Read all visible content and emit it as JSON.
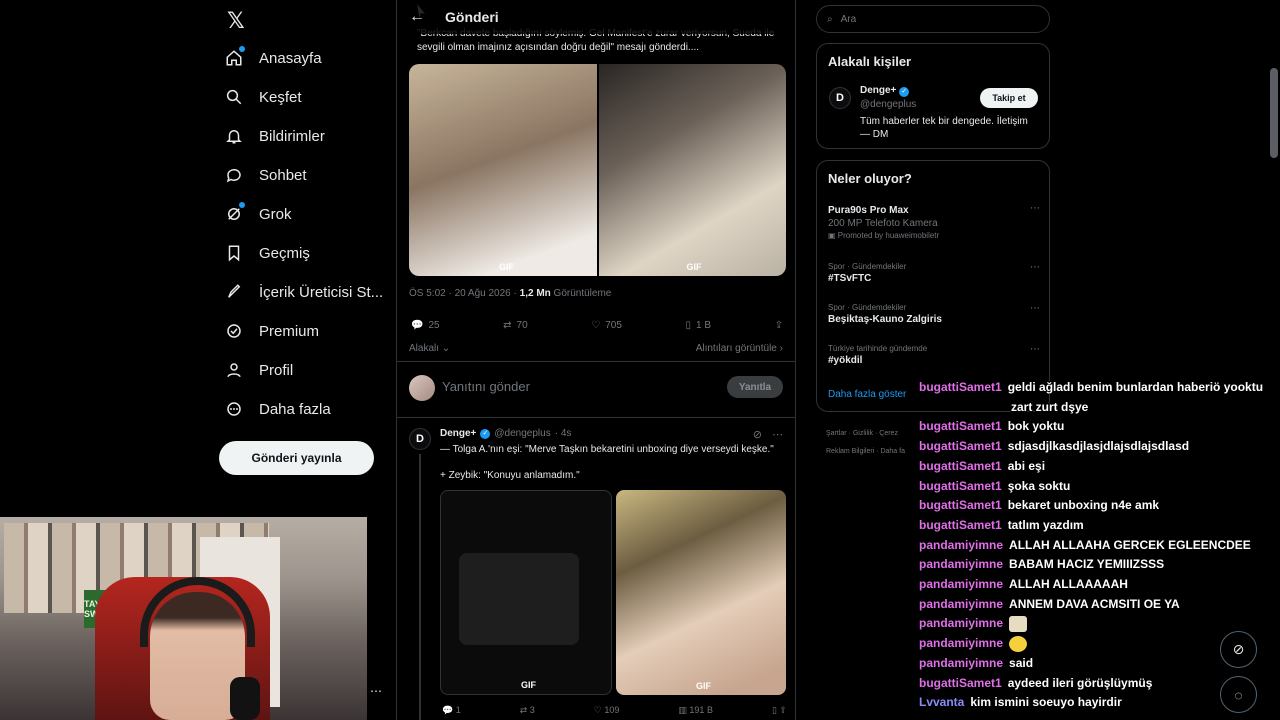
{
  "nav": {
    "items": [
      {
        "label": "Anasayfa",
        "icon": "home-icon"
      },
      {
        "label": "Keşfet",
        "icon": "search-icon"
      },
      {
        "label": "Bildirimler",
        "icon": "bell-icon"
      },
      {
        "label": "Sohbet",
        "icon": "chat-icon"
      },
      {
        "label": "Grok",
        "icon": "grok-icon"
      },
      {
        "label": "Geçmiş",
        "icon": "bookmark-icon"
      },
      {
        "label": "İçerik Üreticisi St...",
        "icon": "rocket-icon"
      },
      {
        "label": "Premium",
        "icon": "verified-icon"
      },
      {
        "label": "Profil",
        "icon": "person-icon"
      },
      {
        "label": "Daha fazla",
        "icon": "more-icon"
      }
    ],
    "post_button": "Gönderi yayınla"
  },
  "header": {
    "title": "Gönderi"
  },
  "tweet": {
    "text": "\"Berkcan davete başladığını söylemiş. Gel Manifest'e zurar veriyorsun, Sueda ile sevgili olman imajınız açısından doğru değil\" mesajı gönderdi....",
    "gif_label": "GIF",
    "time": "ÖS 5:02 · 20 Ağu 2026 ·",
    "views": "1,2 Mn",
    "views_label": "Görüntüleme",
    "replies": "25",
    "reposts": "70",
    "likes": "705",
    "bookmarks": "1 B",
    "relevance": "Alakalı",
    "quotes_link": "Alıntıları görüntüle"
  },
  "reply": {
    "placeholder": "Yanıtını gönder",
    "button": "Yanıtla"
  },
  "tweet2": {
    "name": "Denge+",
    "handle": "@dengeplus",
    "age": "· 4s",
    "line1": "— Tolga A.'nın eşi: \"Merve Taşkın bekaretini unboxing diye verseydi keşke.\"",
    "line2": "+ Zeybik: \"Konuyu anlamadım.\"",
    "replies": "1",
    "reposts": "3",
    "likes": "109",
    "views": "191 B"
  },
  "search": {
    "placeholder": "Ara"
  },
  "who": {
    "title": "Alakalı kişiler",
    "name": "Denge+",
    "handle": "@dengeplus",
    "follow": "Takip et",
    "bio": "Tüm haberler tek bir dengede. İletişim — DM"
  },
  "trends": {
    "title": "Neler oluyor?",
    "items": [
      {
        "cat": "",
        "title": "Pura90s Pro Max",
        "sub": "200 MP Telefoto Kamera",
        "promo": "Promoted by huaweimobiletr"
      },
      {
        "cat": "Spor · Gündemdekiler",
        "title": "#TSvFTC",
        "sub": "",
        "promo": ""
      },
      {
        "cat": "Spor · Gündemdekiler",
        "title": "Beşiktaş-Kauno Zalgiris",
        "sub": "",
        "promo": ""
      },
      {
        "cat": "Türkiye tarihinde gündemde",
        "title": "#yökdil",
        "sub": "",
        "promo": ""
      }
    ],
    "show_more": "Daha fazla göster"
  },
  "footer": {
    "line1": "Şartlar · Gizlilik · Çerez",
    "line2": "Reklam Bilgileri · Daha fa"
  },
  "chat": {
    "colors": {
      "bugattiSamet1": "#e06fe8",
      "pandamiyimne": "#e06fe8",
      "Lvvanta": "#8a8cf7"
    },
    "messages": [
      {
        "user": "bugattiSamet1",
        "text": "geldi ağladı benim bunlardan haberiö yooktu",
        "emote": ""
      },
      {
        "user": "",
        "text": "zart zurt dşye",
        "emote": ""
      },
      {
        "user": "bugattiSamet1",
        "text": "bok yoktu",
        "emote": ""
      },
      {
        "user": "bugattiSamet1",
        "text": "sdjasdjlkasdjlasjdlajsdlajsdlasd",
        "emote": ""
      },
      {
        "user": "bugattiSamet1",
        "text": "abi eşi",
        "emote": ""
      },
      {
        "user": "bugattiSamet1",
        "text": "şoka soktu",
        "emote": ""
      },
      {
        "user": "bugattiSamet1",
        "text": "bekaret unboxing n4e amk",
        "emote": ""
      },
      {
        "user": "bugattiSamet1",
        "text": "tatlım yazdım",
        "emote": ""
      },
      {
        "user": "pandamiyimne",
        "text": "ALLAH ALLAAHA GERCEK EGLEENCDEE",
        "emote": ""
      },
      {
        "user": "pandamiyimne",
        "text": "BABAM HACIZ YEMIIIZSSS",
        "emote": ""
      },
      {
        "user": "pandamiyimne",
        "text": "ALLAH ALLAAAAAH",
        "emote": ""
      },
      {
        "user": "pandamiyimne",
        "text": "ANNEM DAVA ACMSITI OE YA",
        "emote": ""
      },
      {
        "user": "pandamiyimne",
        "text": "",
        "emote": "emote-cat"
      },
      {
        "user": "pandamiyimne",
        "text": "",
        "emote": "emote-yellow"
      },
      {
        "user": "pandamiyimne",
        "text": "said",
        "emote": ""
      },
      {
        "user": "bugattiSamet1",
        "text": "aydeed ileri görüşlüymüş",
        "emote": ""
      },
      {
        "user": "Lvvanta",
        "text": "kim ismini soeuyo hayirdir",
        "emote": ""
      }
    ]
  },
  "webcam": {
    "poster_text": "TAYLOR SWIFT"
  }
}
